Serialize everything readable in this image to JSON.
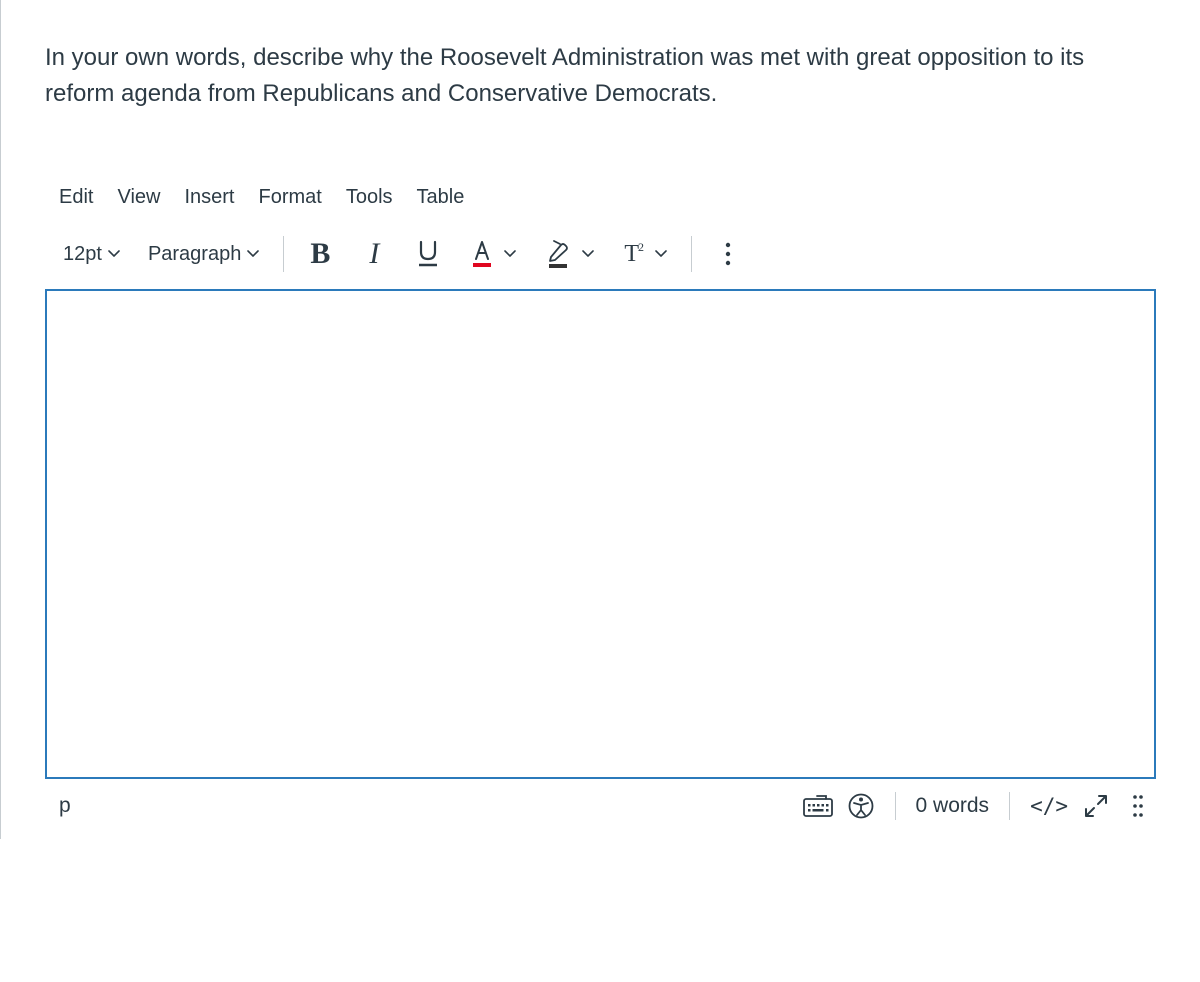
{
  "prompt_text": "In your own words, describe why the Roosevelt Administration was met with great opposition to its reform agenda from Republicans and Conservative Democrats.",
  "menubar": {
    "edit": "Edit",
    "view": "View",
    "insert": "Insert",
    "format": "Format",
    "tools": "Tools",
    "table": "Table"
  },
  "toolbar": {
    "font_size": "12pt",
    "block_format": "Paragraph",
    "bold": "B",
    "italic": "I",
    "superscript_t": "T",
    "superscript_2": "2"
  },
  "statusbar": {
    "path": "p",
    "word_count": "0 words",
    "code_view": "</>"
  },
  "colors": {
    "text": "#2d3b45",
    "active_border": "#2b7abb",
    "underline_red": "#e0061f",
    "highlight_underline": "#333333"
  }
}
